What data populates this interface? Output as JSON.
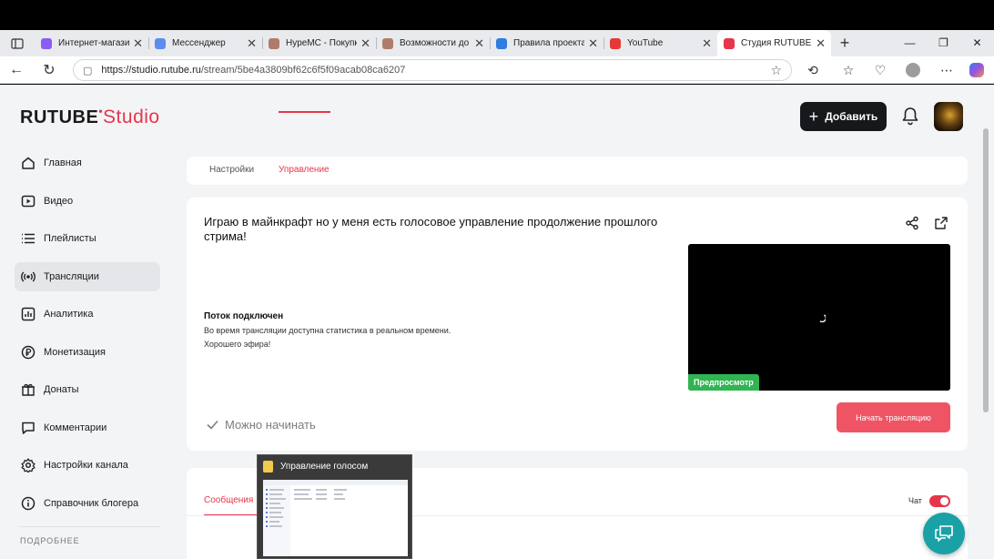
{
  "browser": {
    "tabs": [
      {
        "title": "Интернет-магази",
        "color": "#8b5cf6",
        "active": false
      },
      {
        "title": "Мессенджер",
        "color": "#5b8def",
        "active": false
      },
      {
        "title": "HypeMC - Покупк",
        "color": "#b07c6a",
        "active": false
      },
      {
        "title": "Возможности до",
        "color": "#b07c6a",
        "active": false
      },
      {
        "title": "Правила проекта",
        "color": "#2f7de1",
        "active": false
      },
      {
        "title": "YouTube",
        "color": "#e53935",
        "active": false
      },
      {
        "title": "Студия RUTUBE",
        "color": "#e6364b",
        "active": true
      }
    ],
    "url_host": "https://studio.rutube.ru",
    "url_path": "/stream/5be4a3809bf62c6f5f09acab08ca6207"
  },
  "header": {
    "logo_main": "RUTUBE",
    "logo_accent": "Studio",
    "add_label": "Добавить"
  },
  "sidebar": {
    "items": [
      {
        "label": "Главная",
        "icon": "home-icon"
      },
      {
        "label": "Видео",
        "icon": "video-icon"
      },
      {
        "label": "Плейлисты",
        "icon": "playlist-icon"
      },
      {
        "label": "Трансляции",
        "icon": "broadcast-icon"
      },
      {
        "label": "Аналитика",
        "icon": "analytics-icon"
      },
      {
        "label": "Монетизация",
        "icon": "ruble-icon"
      },
      {
        "label": "Донаты",
        "icon": "donate-icon"
      },
      {
        "label": "Комментарии",
        "icon": "comments-icon"
      },
      {
        "label": "Настройки канала",
        "icon": "settings-icon"
      },
      {
        "label": "Справочник блогера",
        "icon": "info-icon"
      }
    ],
    "more_label": "ПОДРОБНЕЕ"
  },
  "page_tabs": {
    "settings": "Настройки",
    "management": "Управление"
  },
  "stream": {
    "title": "Играю в майнкрафт но у меня есть голосовое управление продолжение прошлого стрима!",
    "status_heading": "Поток подключен",
    "status_line1": "Во время трансляции доступна статистика в реальном времени.",
    "status_line2": "Хорошего эфира!",
    "ready_label": "Можно начинать",
    "preview_badge": "Предпросмотр",
    "start_button": "Начать трансляцию"
  },
  "chat": {
    "tab_label": "Сообщения",
    "toggle_label": "Чат",
    "enabled": true
  },
  "taskbar_preview": {
    "title": "Управление голосом"
  },
  "colors": {
    "accent": "#e6364b",
    "success": "#31b452",
    "start_button": "#ef5465",
    "help": "#1aa1a6"
  }
}
